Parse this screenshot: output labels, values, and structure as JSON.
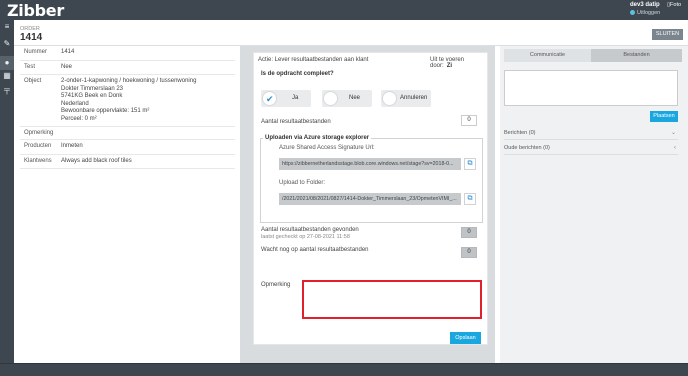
{
  "app": {
    "logo": "Zibber",
    "user": "dev3 datip",
    "logout": "Uitloggen",
    "foto": "Foto"
  },
  "nav": {
    "icons": [
      "menu-icon",
      "wrench-icon",
      "user-icon",
      "map-icon",
      "signpost-icon"
    ]
  },
  "header": {
    "order_label": "ORDER",
    "order_number": "1414",
    "close_label": "SLUITEN"
  },
  "details": {
    "rows": [
      {
        "label": "Nummer",
        "lines": [
          "1414"
        ]
      },
      {
        "label": "Test",
        "lines": [
          "Nee"
        ]
      },
      {
        "label": "Object",
        "lines": [
          "2-onder-1-kapwoning / hoekwoning / tussenwoning",
          "Dokter Timmerslaan 23",
          "5741KG Beek en Donk",
          "Nederland",
          "Bewoonbare oppervlakte: 151 m²",
          "Perceel: 0 m²"
        ]
      },
      {
        "label": "Opmerking",
        "lines": [
          ""
        ]
      },
      {
        "label": "Producten",
        "lines": [
          "Inmeten"
        ]
      },
      {
        "label": "Klantwens",
        "lines": [
          "Always add black roof tiles"
        ]
      }
    ]
  },
  "task": {
    "actie": "Actie: Lever resultaatbestanden aan klant",
    "uit_te_voeren_door": "Uit te voeren door:",
    "uit_te_voeren_door_value": "Zi",
    "question": "Is de opdracht compleet?",
    "options": [
      {
        "label": "Ja",
        "selected": true
      },
      {
        "label": "Nee",
        "selected": false
      },
      {
        "label": "Annuleren",
        "selected": false
      }
    ],
    "aantal_label": "Aantal resultaatbestanden",
    "aantal_value": "0",
    "upload_legend": "Uploaden via Azure storage explorer",
    "sas_label": "Azure Shared Access Signature Url:",
    "sas_value": "https://zibbernetherlandsstage.blob.core.windows.net/stage?sv=2018-0...",
    "folder_label": "Upload to Folder:",
    "folder_value": "/2021/2021/08/2021/0827/1414-Dokter_Timmerslaan_23/OpmetenVIMI_...",
    "gevonden_label": "Aantal resultaatbestanden gevonden",
    "gecheckt": "laatst gecheckt op 27-08-2021 11:58",
    "gevonden_value": "0",
    "wacht_label": "Wacht nog op aantal resultaatbestanden",
    "wacht_value": "0",
    "opmerking_label": "Opmerking",
    "opmerking_value": "",
    "save_label": "Opslaan"
  },
  "sidebar": {
    "tabs": [
      {
        "label": "Communicatie",
        "active": true
      },
      {
        "label": "Bestanden",
        "active": false
      }
    ],
    "comment_value": "",
    "post_label": "Plaatsen",
    "accordion": [
      {
        "label": "Berichten (0)",
        "chevron": "chevron-down-icon"
      },
      {
        "label": "Oude berichten (0)",
        "chevron": "chevron-left-icon"
      }
    ]
  }
}
